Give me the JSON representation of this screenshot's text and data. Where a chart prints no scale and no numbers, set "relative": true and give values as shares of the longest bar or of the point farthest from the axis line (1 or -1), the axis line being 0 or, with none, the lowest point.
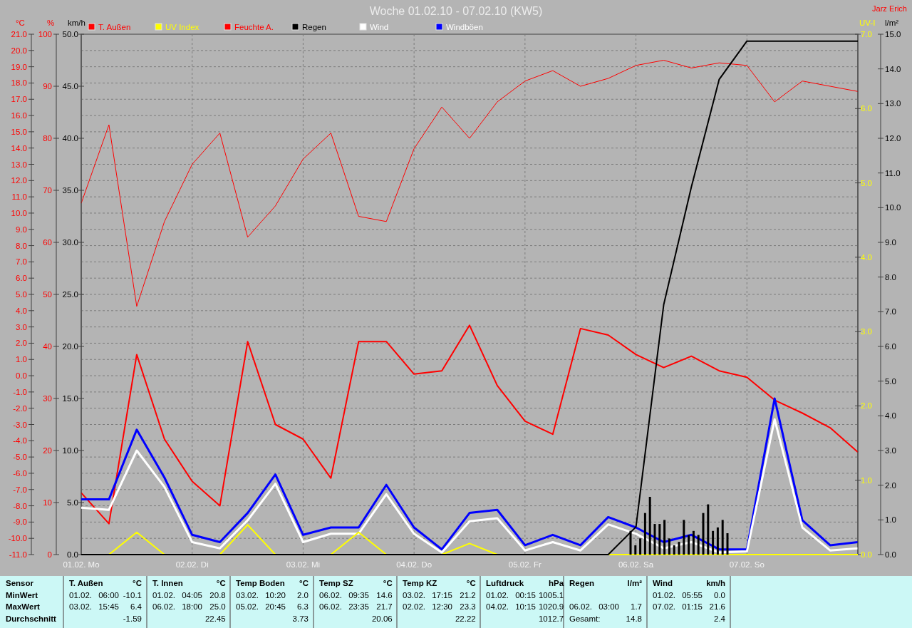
{
  "title": "Woche 01.02.10 - 07.02.10 (KW5)",
  "author": "Jarz Erich",
  "charts": [
    {
      "chart_data": {
        "type": "line",
        "ylabel": "°C",
        "ylim": [
          -11,
          21
        ],
        "categories": [
          "01.02. Mo",
          null,
          null,
          null,
          "02.02. Di",
          null,
          null,
          null,
          "03.02. Mi",
          null,
          null,
          null,
          "04.02. Do",
          null,
          null,
          null,
          "05.02. Fr",
          null,
          null,
          null,
          "06.02. Sa",
          null,
          null,
          null,
          "07.02. So",
          null,
          null,
          null,
          null
        ],
        "yticks": [
          {
            "value": -11,
            "label": "-11.0"
          },
          {
            "value": -10,
            "label": "-10.0"
          },
          {
            "value": -9,
            "label": "-9.0"
          },
          {
            "value": -8,
            "label": "-8.0"
          },
          {
            "value": -7,
            "label": "-7.0"
          },
          {
            "value": -6,
            "label": "-6.0"
          },
          {
            "value": -5,
            "label": "-5.0"
          },
          {
            "value": -4,
            "label": "-4.0"
          },
          {
            "value": -3,
            "label": "-3.0"
          },
          {
            "value": -2,
            "label": "-2.0"
          },
          {
            "value": -1,
            "label": "-1.0"
          },
          {
            "value": 0,
            "label": "0.0"
          },
          {
            "value": 1,
            "label": "1.0"
          },
          {
            "value": 2,
            "label": "2.0"
          },
          {
            "value": 3,
            "label": "3.0"
          },
          {
            "value": 4,
            "label": "4.0"
          },
          {
            "value": 5,
            "label": "5.0"
          },
          {
            "value": 6,
            "label": "6.0"
          },
          {
            "value": 7,
            "label": "7.0"
          },
          {
            "value": 8,
            "label": "8.0"
          },
          {
            "value": 9,
            "label": "9.0"
          },
          {
            "value": 10,
            "label": "10.0"
          },
          {
            "value": 11,
            "label": "11.0"
          },
          {
            "value": 12,
            "label": "12.0"
          },
          {
            "value": 13,
            "label": "13.0"
          },
          {
            "value": 14,
            "label": "14.0"
          },
          {
            "value": 15,
            "label": "15.0"
          },
          {
            "value": 16,
            "label": "16.0"
          },
          {
            "value": 17,
            "label": "17.0"
          },
          {
            "value": 18,
            "label": "18.0"
          },
          {
            "value": 19,
            "label": "19.0"
          },
          {
            "value": 20,
            "label": "20.0"
          },
          {
            "value": 21,
            "label": "21.0"
          }
        ],
        "series": [
          {
            "name": "T. Außen",
            "color": "#ff0000",
            "values": [
              -7.2,
              -9.1,
              1.3,
              -3.9,
              -6.5,
              -8.0,
              2.1,
              -3.0,
              -3.9,
              -6.3,
              2.1,
              2.1,
              0.1,
              0.3,
              3.1,
              -0.6,
              -2.8,
              -3.6,
              2.9,
              2.5,
              1.3,
              0.5,
              1.2,
              0.3,
              -0.1,
              -1.5,
              -2.3,
              -3.2,
              -4.7
            ]
          }
        ]
      }
    },
    {
      "chart_data": {
        "type": "line",
        "ylabel": "%",
        "ylim": [
          0,
          100
        ],
        "categories": [
          null,
          null,
          null,
          null,
          null,
          null,
          null,
          null,
          null,
          null,
          null,
          null,
          null,
          null,
          null,
          null,
          null,
          null,
          null,
          null,
          null,
          null,
          null,
          null,
          null,
          null,
          null,
          null,
          null
        ],
        "yticks": [
          {
            "value": 0,
            "label": "0"
          },
          {
            "value": 10,
            "label": "10"
          },
          {
            "value": 20,
            "label": "20"
          },
          {
            "value": 30,
            "label": "30"
          },
          {
            "value": 40,
            "label": "40"
          },
          {
            "value": 50,
            "label": "50"
          },
          {
            "value": 60,
            "label": "60"
          },
          {
            "value": 70,
            "label": "70"
          },
          {
            "value": 80,
            "label": "80"
          },
          {
            "value": 90,
            "label": "90"
          },
          {
            "value": 100,
            "label": "100"
          }
        ],
        "series": [
          {
            "name": "Feuchte A.",
            "color": "#ff0000",
            "values": [
              67.5,
              82.6,
              47.7,
              64,
              75,
              81,
              61,
              67,
              76,
              81,
              65,
              64,
              78,
              86,
              80,
              87,
              91,
              93,
              90,
              91.5,
              94,
              95,
              93.5,
              94.5,
              94,
              87,
              91,
              90,
              89
            ]
          }
        ]
      }
    },
    {
      "chart_data": {
        "type": "line",
        "ylabel": "km/h",
        "ylim": [
          0,
          50
        ],
        "categories": [
          null,
          null,
          null,
          null,
          null,
          null,
          null,
          null,
          null,
          null,
          null,
          null,
          null,
          null,
          null,
          null,
          null,
          null,
          null,
          null,
          null,
          null,
          null,
          null,
          null,
          null,
          null,
          null,
          null
        ],
        "yticks": [
          {
            "value": 0,
            "label": "0.0"
          },
          {
            "value": 5,
            "label": "5.0"
          },
          {
            "value": 10,
            "label": "10.0"
          },
          {
            "value": 15,
            "label": "15.0"
          },
          {
            "value": 20,
            "label": "20.0"
          },
          {
            "value": 25,
            "label": "25.0"
          },
          {
            "value": 30,
            "label": "30.0"
          },
          {
            "value": 35,
            "label": "35.0"
          },
          {
            "value": 40,
            "label": "40.0"
          },
          {
            "value": 45,
            "label": "45.0"
          },
          {
            "value": 50,
            "label": "50.0"
          }
        ],
        "series": [
          {
            "name": "Windböen",
            "color": "#0000ff",
            "values": [
              5.3,
              5.3,
              12,
              7.4,
              1.9,
              1.2,
              4,
              7.7,
              1.9,
              2.6,
              2.6,
              6.7,
              2.6,
              0.5,
              4,
              4.3,
              0.9,
              1.9,
              0.9,
              3.6,
              2.6,
              1.2,
              1.9,
              0.5,
              0.5,
              15,
              3.3,
              0.9,
              1.2
            ]
          },
          {
            "name": "Wind",
            "color": "#ffffff",
            "values": [
              4.5,
              4.3,
              10,
              6.5,
              1.2,
              0.6,
              3.3,
              6.8,
              1.2,
              2,
              2,
              5.8,
              2,
              0.2,
              3.2,
              3.5,
              0.4,
              1.2,
              0.4,
              2.9,
              2,
              0.6,
              1.2,
              0.2,
              0.3,
              13,
              2.6,
              0.4,
              0.6
            ]
          }
        ]
      }
    },
    {
      "chart_data": {
        "type": "line",
        "ylabel": "UV-I",
        "ylim": [
          0,
          7
        ],
        "categories": [
          null,
          null,
          null,
          null,
          null,
          null,
          null,
          null,
          null,
          null,
          null,
          null,
          null,
          null,
          null,
          null,
          null,
          null,
          null,
          null,
          null,
          null,
          null,
          null,
          null,
          null,
          null,
          null,
          null
        ],
        "yticks": [
          {
            "value": 0,
            "label": "0.0"
          },
          {
            "value": 1,
            "label": "1.0"
          },
          {
            "value": 2,
            "label": "2.0"
          },
          {
            "value": 3,
            "label": "3.0"
          },
          {
            "value": 4,
            "label": "4.0"
          },
          {
            "value": 5,
            "label": "5.0"
          },
          {
            "value": 6,
            "label": "6.0"
          },
          {
            "value": 7,
            "label": "7.0"
          }
        ],
        "series": [
          {
            "name": "UV Index",
            "color": "#ffff00",
            "values": [
              0,
              0,
              0.3,
              0,
              0,
              0,
              0.4,
              0,
              0,
              0,
              0.3,
              0,
              0,
              0,
              0.15,
              0,
              0,
              0,
              0,
              0,
              0,
              0,
              0,
              0,
              0,
              0,
              0,
              0,
              0
            ]
          }
        ]
      }
    },
    {
      "chart_data": {
        "type": "line",
        "ylabel": "l/m²",
        "ylim": [
          0,
          15
        ],
        "categories": [
          null,
          null,
          null,
          null,
          null,
          null,
          null,
          null,
          null,
          null,
          null,
          null,
          null,
          null,
          null,
          null,
          null,
          null,
          null,
          null,
          null,
          null,
          null,
          null,
          null,
          null,
          null,
          null,
          null
        ],
        "yticks": [
          {
            "value": 0,
            "label": "0.0"
          },
          {
            "value": 1,
            "label": "1.0"
          },
          {
            "value": 2,
            "label": "2.0"
          },
          {
            "value": 3,
            "label": "3.0"
          },
          {
            "value": 4,
            "label": "4.0"
          },
          {
            "value": 5,
            "label": "5.0"
          },
          {
            "value": 6,
            "label": "6.0"
          },
          {
            "value": 7,
            "label": "7.0"
          },
          {
            "value": 8,
            "label": "8.0"
          },
          {
            "value": 9,
            "label": "9.0"
          },
          {
            "value": 10,
            "label": "10.0"
          },
          {
            "value": 11,
            "label": "11.0"
          },
          {
            "value": 12,
            "label": "12.0"
          },
          {
            "value": 13,
            "label": "13.0"
          },
          {
            "value": 14,
            "label": "14.0"
          },
          {
            "value": 15,
            "label": "15.0"
          }
        ],
        "series": [
          {
            "name": "Regen",
            "color": "#000000",
            "values": [
              0,
              0,
              0,
              0,
              0,
              0,
              0,
              0,
              0,
              0,
              0,
              0,
              0,
              0,
              0,
              0,
              0,
              0,
              0,
              0,
              0.8,
              7.2,
              10.6,
              13.7,
              14.8,
              14.8,
              14.8,
              14.8,
              14.8
            ]
          }
        ]
      }
    },
    {
      "chart_data": {
        "type": "bar",
        "relative": true,
        "categories": [
          null,
          null,
          null,
          null,
          null,
          null,
          null,
          null,
          null,
          null,
          null,
          null,
          null,
          null,
          null,
          null,
          null,
          null,
          null,
          null,
          null
        ],
        "series": [
          {
            "color": "#000000",
            "values": [
              0.41,
              0.16,
              0.28,
              0.72,
              1,
              0.53,
              0.53,
              0.6,
              0.28,
              0.16,
              0.22,
              0.6,
              0.34,
              0.41,
              0.34,
              0.72,
              0.87,
              0.41,
              0.47,
              0.6,
              0.37
            ]
          }
        ]
      }
    }
  ],
  "stats": {
    "row_labels": [
      "Sensor",
      "MinWert",
      "MaxWert",
      "Durchschnitt"
    ],
    "sensors": [
      {
        "name": "T. Außen",
        "unit": "°C",
        "rows": [
          {
            "when": "01.02. 06:00",
            "value": "-10.1"
          },
          {
            "when": "03.02. 15:45",
            "value": "6.4"
          },
          {
            "value": "-1.59"
          }
        ]
      },
      {
        "name": "T. Innen",
        "unit": "°C",
        "rows": [
          {
            "when": "01.02. 04:05",
            "value": "20.8"
          },
          {
            "when": "06.02. 18:00",
            "value": "25.0"
          },
          {
            "value": "22.45"
          }
        ]
      },
      {
        "name": "Temp Boden",
        "unit": "°C",
        "rows": [
          {
            "when": "03.02. 10:20",
            "value": "2.0"
          },
          {
            "when": "05.02. 20:45",
            "value": "6.3"
          },
          {
            "value": "3.73"
          }
        ]
      },
      {
        "name": "Temp SZ",
        "unit": "°C",
        "rows": [
          {
            "when": "06.02. 09:35",
            "value": "14.6"
          },
          {
            "when": "06.02. 23:35",
            "value": "21.7"
          },
          {
            "value": "20.06"
          }
        ]
      },
      {
        "name": "Temp KZ",
        "unit": "°C",
        "rows": [
          {
            "when": "03.02. 17:15",
            "value": "21.2"
          },
          {
            "when": "02.02. 12:30",
            "value": "23.3"
          },
          {
            "value": "22.22"
          }
        ]
      },
      {
        "name": "Luftdruck",
        "unit": "hPa",
        "rows": [
          {
            "when": "01.02. 00:15",
            "value": "1005.1"
          },
          {
            "when": "04.02. 10:15",
            "value": "1020.9"
          },
          {
            "value": "1012.7"
          }
        ]
      },
      {
        "name": "Regen",
        "unit": "l/m²",
        "rows": [
          {},
          {
            "when": "06.02. 03:00",
            "value": "1.7"
          },
          {
            "when": "Gesamt:",
            "value": "14.8"
          }
        ]
      },
      {
        "name": "Wind",
        "unit": "km/h",
        "rows": [
          {
            "when": "01.02. 05:55",
            "value": "0.0"
          },
          {
            "when": "07.02. 01:15",
            "value": "21.6"
          },
          {
            "value": "2.4"
          }
        ]
      }
    ]
  }
}
